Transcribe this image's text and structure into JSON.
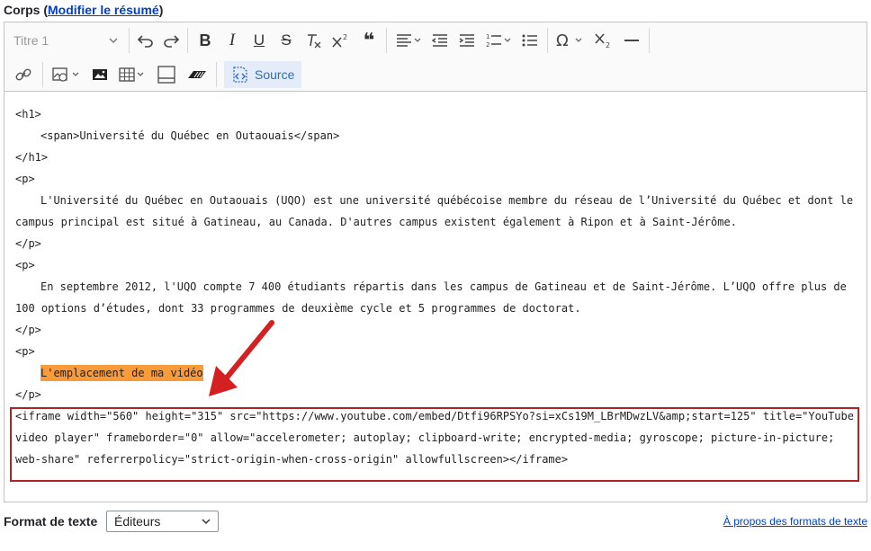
{
  "field": {
    "label": "Corps",
    "paren_open": "(",
    "summary_link": "Modifier le résumé",
    "paren_close": ")"
  },
  "toolbar": {
    "heading_value": "Titre 1",
    "source_label": "Source",
    "icons": [
      "undo-icon",
      "redo-icon",
      "bold-icon",
      "italic-icon",
      "underline-icon",
      "strikethrough-icon",
      "remove-format-icon",
      "superscript-icon",
      "blockquote-icon",
      "align-icon",
      "outdent-icon",
      "indent-icon",
      "numbered-list-icon",
      "bulleted-list-icon",
      "special-characters-icon",
      "subscript-icon",
      "horizontal-line-icon",
      "link-icon",
      "image-icon",
      "media-icon",
      "table-icon",
      "insert-block-icon",
      "code-block-icon",
      "source-icon"
    ]
  },
  "source_lines": [
    "<h1>",
    "<span>Université du Québec en Outaouais</span>",
    "</h1>",
    "<p>",
    "L'Université du Québec en Outaouais (UQO) est une université québécoise membre du réseau de l’Université du Québec et dont le",
    "campus principal est situé à Gatineau, au Canada. D'autres campus existent également à Ripon et à Saint-Jérôme.",
    "</p>",
    "<p>",
    "En septembre 2012, l'UQO compte 7 400 étudiants répartis dans les campus de Gatineau et de Saint-Jérôme. L’UQO offre plus de",
    "100 options d’études, dont 33 programmes de deuxième cycle et 5 programmes de doctorat.",
    "</p>",
    "<p>",
    "L'emplacement de ma vidéo",
    "</p>",
    "<iframe width=\"560\" height=\"315\" src=\"https://www.youtube.com/embed/Dtfi96RPSYo?si=xCs19M_LBrMDwzLV&amp;start=125\" title=\"YouTube",
    "video player\" frameborder=\"0\" allow=\"accelerometer; autoplay; clipboard-write; encrypted-media; gyroscope; picture-in-picture;",
    "web-share\" referrerpolicy=\"strict-origin-when-cross-origin\" allowfullscreen></iframe>"
  ],
  "text_format": {
    "label": "Format de texte",
    "value": "Éditeurs",
    "about_link": "À propos des formats de texte"
  },
  "colors": {
    "highlight": "#f99a3b",
    "annotation_red": "#d42020",
    "link": "#003ecc"
  }
}
